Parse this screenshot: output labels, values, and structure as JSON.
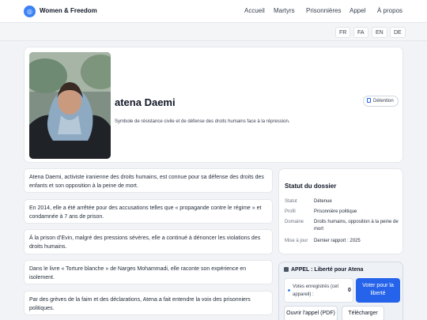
{
  "header": {
    "brand": "Women & Freedom",
    "logo_glyph": "◎",
    "nav": [
      "Accueil",
      "Martyrs",
      "Prisonnières",
      "Appel",
      "À propos"
    ]
  },
  "languages": [
    "FR",
    "FA",
    "EN",
    "DE"
  ],
  "profile": {
    "name": "atena Daemi",
    "subtitle": "Symbole de résistance civile et de défense des droits humains face à la répression.",
    "badge": "Détention"
  },
  "paragraphs": [
    "Atena Daemi, activiste iranienne des droits humains, est connue pour sa défense des droits des enfants et son opposition à la peine de mort.",
    "En 2014, elle a été arrêtée pour des accusations telles que « propagande contre le régime » et condamnée à 7 ans de prison.",
    "À la prison d’Evin, malgré des pressions sévères, elle a continué à dénoncer les violations des droits humains.",
    "Dans le livre « Torture blanche » de Narges Mohammadi, elle raconte son expérience en isolement.",
    "Par des grèves de la faim et des déclarations, Atena a fait entendre la voix des prisonniers politiques."
  ],
  "status": {
    "title": "Statut du dossier",
    "rows": [
      {
        "label": "Statut",
        "value": "Détenue"
      },
      {
        "label": "Profil",
        "value": "Prisonnière politique"
      },
      {
        "label": "Domaine",
        "value": "Droits humains, opposition à la peine de mort"
      },
      {
        "label": "Mise à jour",
        "value": "Dernier rapport : 2025"
      }
    ]
  },
  "appeal": {
    "title": "APPEL : Liberté pour Atena",
    "votes_label": "Votes enregistrés (cet appareil) :",
    "votes_count": "0",
    "vote_button": "Voter pour la liberté",
    "open_pdf": "Ouvrir l'appel (PDF)",
    "download": "Télécharger"
  },
  "colors": {
    "accent": "#2563eb",
    "page_bg": "#f1f3f6",
    "card_bg": "#ffffff"
  }
}
